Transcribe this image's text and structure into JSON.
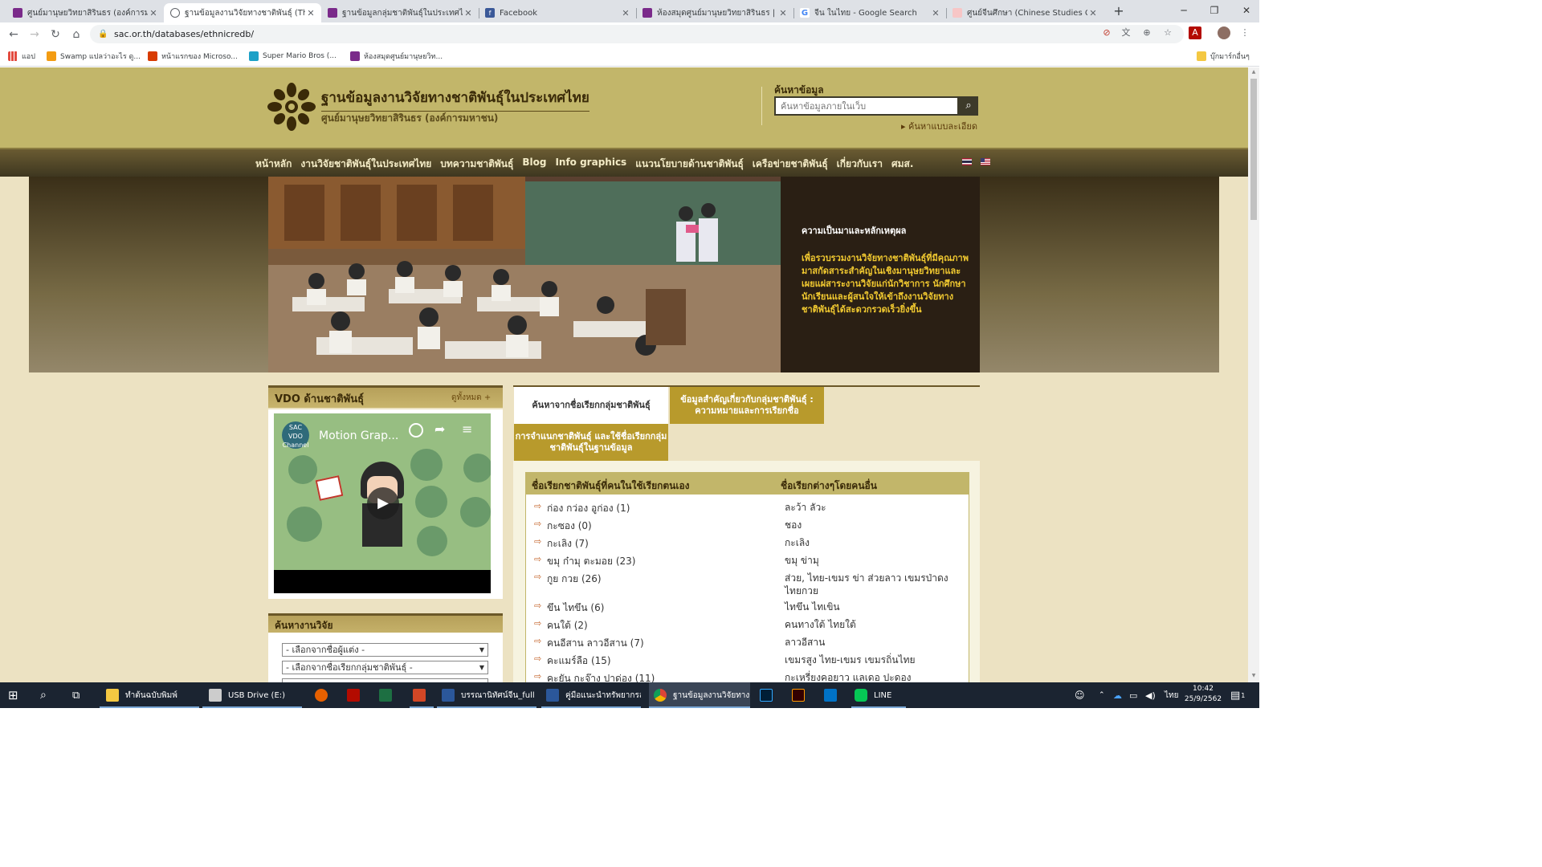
{
  "browser": {
    "tabs": [
      {
        "title": "ศูนย์มานุษยวิทยาสิรินธร (องค์การมหาช",
        "fav_color": "#7a2a8a"
      },
      {
        "title": "ฐานข้อมูลงานวิจัยทางชาติพันธุ์ (Thaila",
        "fav_color": "#5f6368"
      },
      {
        "title": "ฐานข้อมูลกลุ่มชาติพันธุ์ในประเทศไทย",
        "fav_color": "#7a2a8a"
      },
      {
        "title": "Facebook",
        "fav_color": "#3b5998"
      },
      {
        "title": "ห้องสมุดศูนย์มานุษยวิทยาสิรินธร | หน้",
        "fav_color": "#7a2a8a"
      },
      {
        "title": "จีน ในไทย - Google Search",
        "fav_color": "#4285f4"
      },
      {
        "title": "ศูนย์จีนศึกษา (Chinese Studies Cen",
        "fav_color": "#e57373"
      }
    ],
    "new_tab": "+",
    "url": "sac.or.th/databases/ethnicredb/",
    "bookmarks": [
      {
        "label": "แอป",
        "color": "#e34b3f"
      },
      {
        "label": "Swamp แปลว่าอะไร ดู...",
        "color": "#f39c12"
      },
      {
        "label": "หน้าแรกของ Microso...",
        "color": "#d83b01"
      },
      {
        "label": "Super Mario Bros (...",
        "color": "#1da1c7"
      },
      {
        "label": "ห้องสมุดศูนย์มานุษยวิท...",
        "color": "#7a2a8a"
      }
    ],
    "other_bookmarks": "บุ๊กมาร์กอื่นๆ"
  },
  "site": {
    "title": "ฐานข้อมูลงานวิจัยทางชาติพันธุ์ในประเทศไทย",
    "subtitle": "ศูนย์มานุษยวิทยาสิรินธร (องค์การมหาชน)",
    "search_label": "ค้นหาข้อมูล",
    "search_placeholder": "ค้นหาข้อมูลภายในเว็บ",
    "advanced_search": "ค้นหาแบบละเอียด",
    "nav": [
      "หน้าหลัก",
      "งานวิจัยชาติพันธุ์ในประเทศไทย",
      "บทความชาติพันธุ์",
      "Blog",
      "Info graphics",
      "แนวนโยบายด้านชาติพันธุ์",
      "เครือข่ายชาติพันธุ์",
      "เกี่ยวกับเรา",
      "ศมส."
    ]
  },
  "hero": {
    "heading": "ความเป็นมาและหลักเหตุผล",
    "body": "เพื่อรวบรวมงานวิจัยทางชาติพันธุ์ที่มีคุณภาพมาสกัดสาระสำคัญในเชิงมานุษยวิทยาและเผยแผ่สาระงานวิจัยแก่นักวิชาการ นักศึกษานักเรียนและผู้สนใจให้เข้าถึงงานวิจัยทางชาติพันธุ์ได้สะดวกรวดเร็วยิ่งขึ้น"
  },
  "vdo": {
    "title": "VDO ด้านชาติพันธุ์",
    "all_link": "ดูทั้งหมด +",
    "video_title": "Motion Grap...",
    "channel": "SAC VDO Channel"
  },
  "research_search": {
    "title": "ค้นหางานวิจัย",
    "select_author": "- เลือกจากชื่อผู้แต่ง -",
    "select_group": "- เลือกจากชื่อเรียกกลุ่มชาติพันธุ์ -"
  },
  "tabs": [
    {
      "label": "ค้นหาจากชื่อเรียกกลุ่มชาติพันธุ์",
      "active": true
    },
    {
      "label": "ข้อมูลสำคัญเกี่ยวกับกลุ่มชาติพันธุ์ : ความหมายและการเรียกชื่อ",
      "active": false
    },
    {
      "label": "การจำแนกชาติพันธุ์ และใช้ชื่อเรียกกลุ่มชาติพันธุ์ในฐานข้อมูล",
      "active": false
    }
  ],
  "table": {
    "headers": [
      "ชื่อเรียกชาติพันธุ์ที่คนในใช้เรียกตนเอง",
      "ชื่อเรียกต่างๆโดยคนอื่น"
    ],
    "rows": [
      [
        "ก่อง กว่อง อูก่อง (1)",
        "ละว้า ลัวะ"
      ],
      [
        "กะซอง (0)",
        "ชอง"
      ],
      [
        "กะเลิง (7)",
        "กะเลิง"
      ],
      [
        "ขมุ ก๋ามุ ตะมอย (23)",
        "ขมุ ข่ามุ"
      ],
      [
        "กูย กวย (26)",
        "ส่วย, ไทย-เขมร ข่า ส่วยลาว เขมรป่าดง ไทยกวย"
      ],
      [
        "ขึน ไทขึน (6)",
        "ไทขึน ไทเขิน"
      ],
      [
        "คนใต้ (2)",
        "คนทางใต้ ไทยใต้"
      ],
      [
        "คนอีสาน ลาวอีสาน (7)",
        "ลาวอีสาน"
      ],
      [
        "คะแมร์ลือ (15)",
        "เขมรสูง ไทย-เขมร เขมรถิ่นไทย"
      ],
      [
        "คะยัน กะจ๊าง ปาด่อง (11)",
        "กะเหรี่ยงคอยาว แลเดอ ปะดอง"
      ]
    ]
  },
  "taskbar": {
    "items": [
      "ทำต้นฉบับพิมพ์",
      "USB Drive (E:)",
      "บรรณานิทัศน์จีน_full ...",
      "คู่มือแนะนำทรัพยากรสา...",
      "ฐานข้อมูลงานวิจัยทางช...",
      "LINE"
    ],
    "lang": "ไทย",
    "time": "10:42",
    "date": "25/9/2562",
    "notif": "1"
  }
}
